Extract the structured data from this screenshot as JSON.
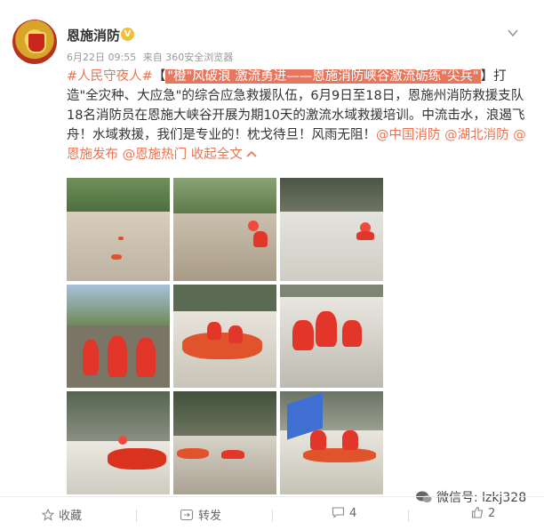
{
  "account": {
    "name": "恩施消防",
    "verified_badge": "V",
    "date": "6月22日 09:55",
    "source": "来自 360安全浏览器"
  },
  "post": {
    "hashtag": "#人民守夜人#",
    "bracket_open": "【",
    "highlight": "\"橙\"风破浪 激流勇进——恩施消防峡谷激流砺练\"尖兵\"",
    "bracket_close": "】",
    "body": "打造\"全灾种、大应急\"的综合应急救援队伍，6月9日至18日，恩施州消防救援支队18名消防员在恩施大峡谷开展为期10天的激流水域救援培训。中流击水，浪遏飞舟！水域救援，我们是专业的！枕戈待旦！风雨无阻！",
    "mentions": [
      "@中国消防",
      "@湖北消防",
      "@恩施发布",
      "@恩施热门"
    ],
    "collapse": "收起全文"
  },
  "photos": [
    {
      "alt": "photo-1-rafts-on-river"
    },
    {
      "alt": "photo-2-swimmer-in-river"
    },
    {
      "alt": "photo-3-swimmer-rapids"
    },
    {
      "alt": "photo-4-team-standing"
    },
    {
      "alt": "photo-5-raft-crew"
    },
    {
      "alt": "photo-6-rescue-in-water"
    },
    {
      "alt": "photo-7-raft-rapids"
    },
    {
      "alt": "photo-8-swimmers-raft"
    },
    {
      "alt": "photo-9-flag-raft"
    }
  ],
  "actions": {
    "favorite": "收藏",
    "repost": "转发",
    "comments": "4",
    "likes": "2"
  },
  "watermark": "微信号: lzkj328",
  "colors": {
    "accent": "#eb7350",
    "highlight_bg": "#e8765c",
    "text": "#333333",
    "meta": "#999999"
  },
  "icons": [
    "verified-icon",
    "chevron-down-icon",
    "star-icon",
    "repost-icon",
    "comment-icon",
    "like-icon",
    "wechat-icon"
  ]
}
